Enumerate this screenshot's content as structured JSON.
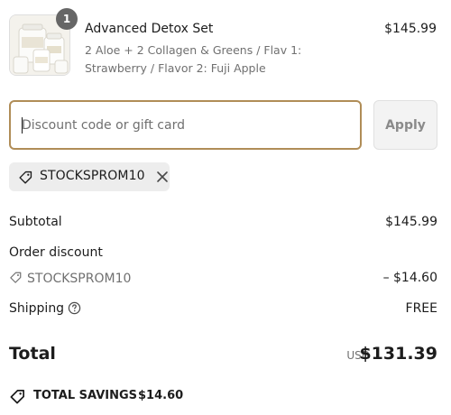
{
  "product": {
    "quantity": "1",
    "name": "Advanced Detox Set",
    "variant": "2 Aloe + 2 Collagen & Greens / Flav 1: Strawberry / Flavor 2: Fuji Apple",
    "price": "$145.99",
    "thumbnail_icon": "product-bottles-image"
  },
  "discount": {
    "placeholder": "Discount code or gift card",
    "apply_label": "Apply",
    "applied_code": "STOCKSPROM10",
    "tag_icon": "tag-icon",
    "remove_icon": "close-icon"
  },
  "summary": {
    "subtotal_label": "Subtotal",
    "subtotal_value": "$145.99",
    "order_discount_label": "Order discount",
    "discount_code": "STOCKSPROM10",
    "discount_value": "– $14.60",
    "shipping_label": "Shipping",
    "shipping_value": "FREE",
    "help_icon": "question-circle-icon"
  },
  "total": {
    "label": "Total",
    "currency": "USD",
    "amount": "$131.39"
  },
  "savings": {
    "label": "TOTAL SAVINGS",
    "amount": "$14.60",
    "icon": "tag-icon"
  },
  "colors": {
    "focus_border": "#b08d57",
    "badge": "#666666",
    "muted_text": "#707070",
    "chip_bg": "#ededed"
  }
}
